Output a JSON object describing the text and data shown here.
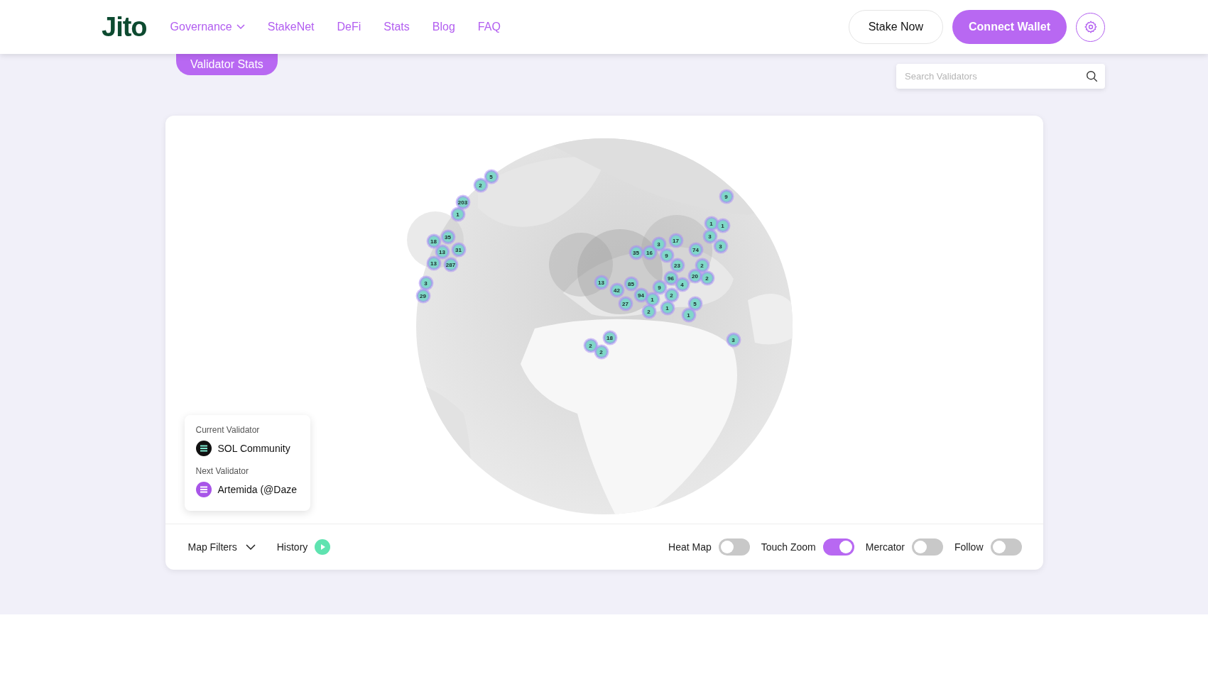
{
  "header": {
    "logo": "Jito",
    "nav": [
      {
        "label": "Governance",
        "kind": "dropdown"
      },
      {
        "label": "StakeNet",
        "kind": "link"
      },
      {
        "label": "DeFi",
        "kind": "link"
      },
      {
        "label": "Stats",
        "kind": "link"
      },
      {
        "label": "Blog",
        "kind": "link"
      },
      {
        "label": "FAQ",
        "kind": "link"
      }
    ],
    "stake_button": "Stake Now",
    "connect_button": "Connect Wallet"
  },
  "validator_stats_button": "Validator Stats",
  "search": {
    "placeholder": "Search Validators"
  },
  "map": {
    "kind": "picture",
    "markers": [
      "5",
      "2",
      "203",
      "1",
      "35",
      "18",
      "31",
      "13",
      "13",
      "287",
      "3",
      "29",
      "9",
      "1",
      "1",
      "3",
      "3",
      "35",
      "16",
      "3",
      "17",
      "74",
      "9",
      "23",
      "2",
      "96",
      "20",
      "2",
      "4",
      "13",
      "42",
      "85",
      "94",
      "1",
      "9",
      "2",
      "27",
      "2",
      "1",
      "5",
      "1",
      "3",
      "18",
      "2",
      "2"
    ],
    "current_label": "Current Validator",
    "current_name": "SOL Community",
    "next_label": "Next Validator",
    "next_name": "Artemida (@Daze"
  },
  "controls": {
    "filters": "Map Filters",
    "history": "History",
    "toggles": [
      {
        "label": "Heat Map",
        "on": false
      },
      {
        "label": "Touch Zoom",
        "on": true
      },
      {
        "label": "Mercator",
        "on": false
      },
      {
        "label": "Follow",
        "on": false
      }
    ]
  }
}
